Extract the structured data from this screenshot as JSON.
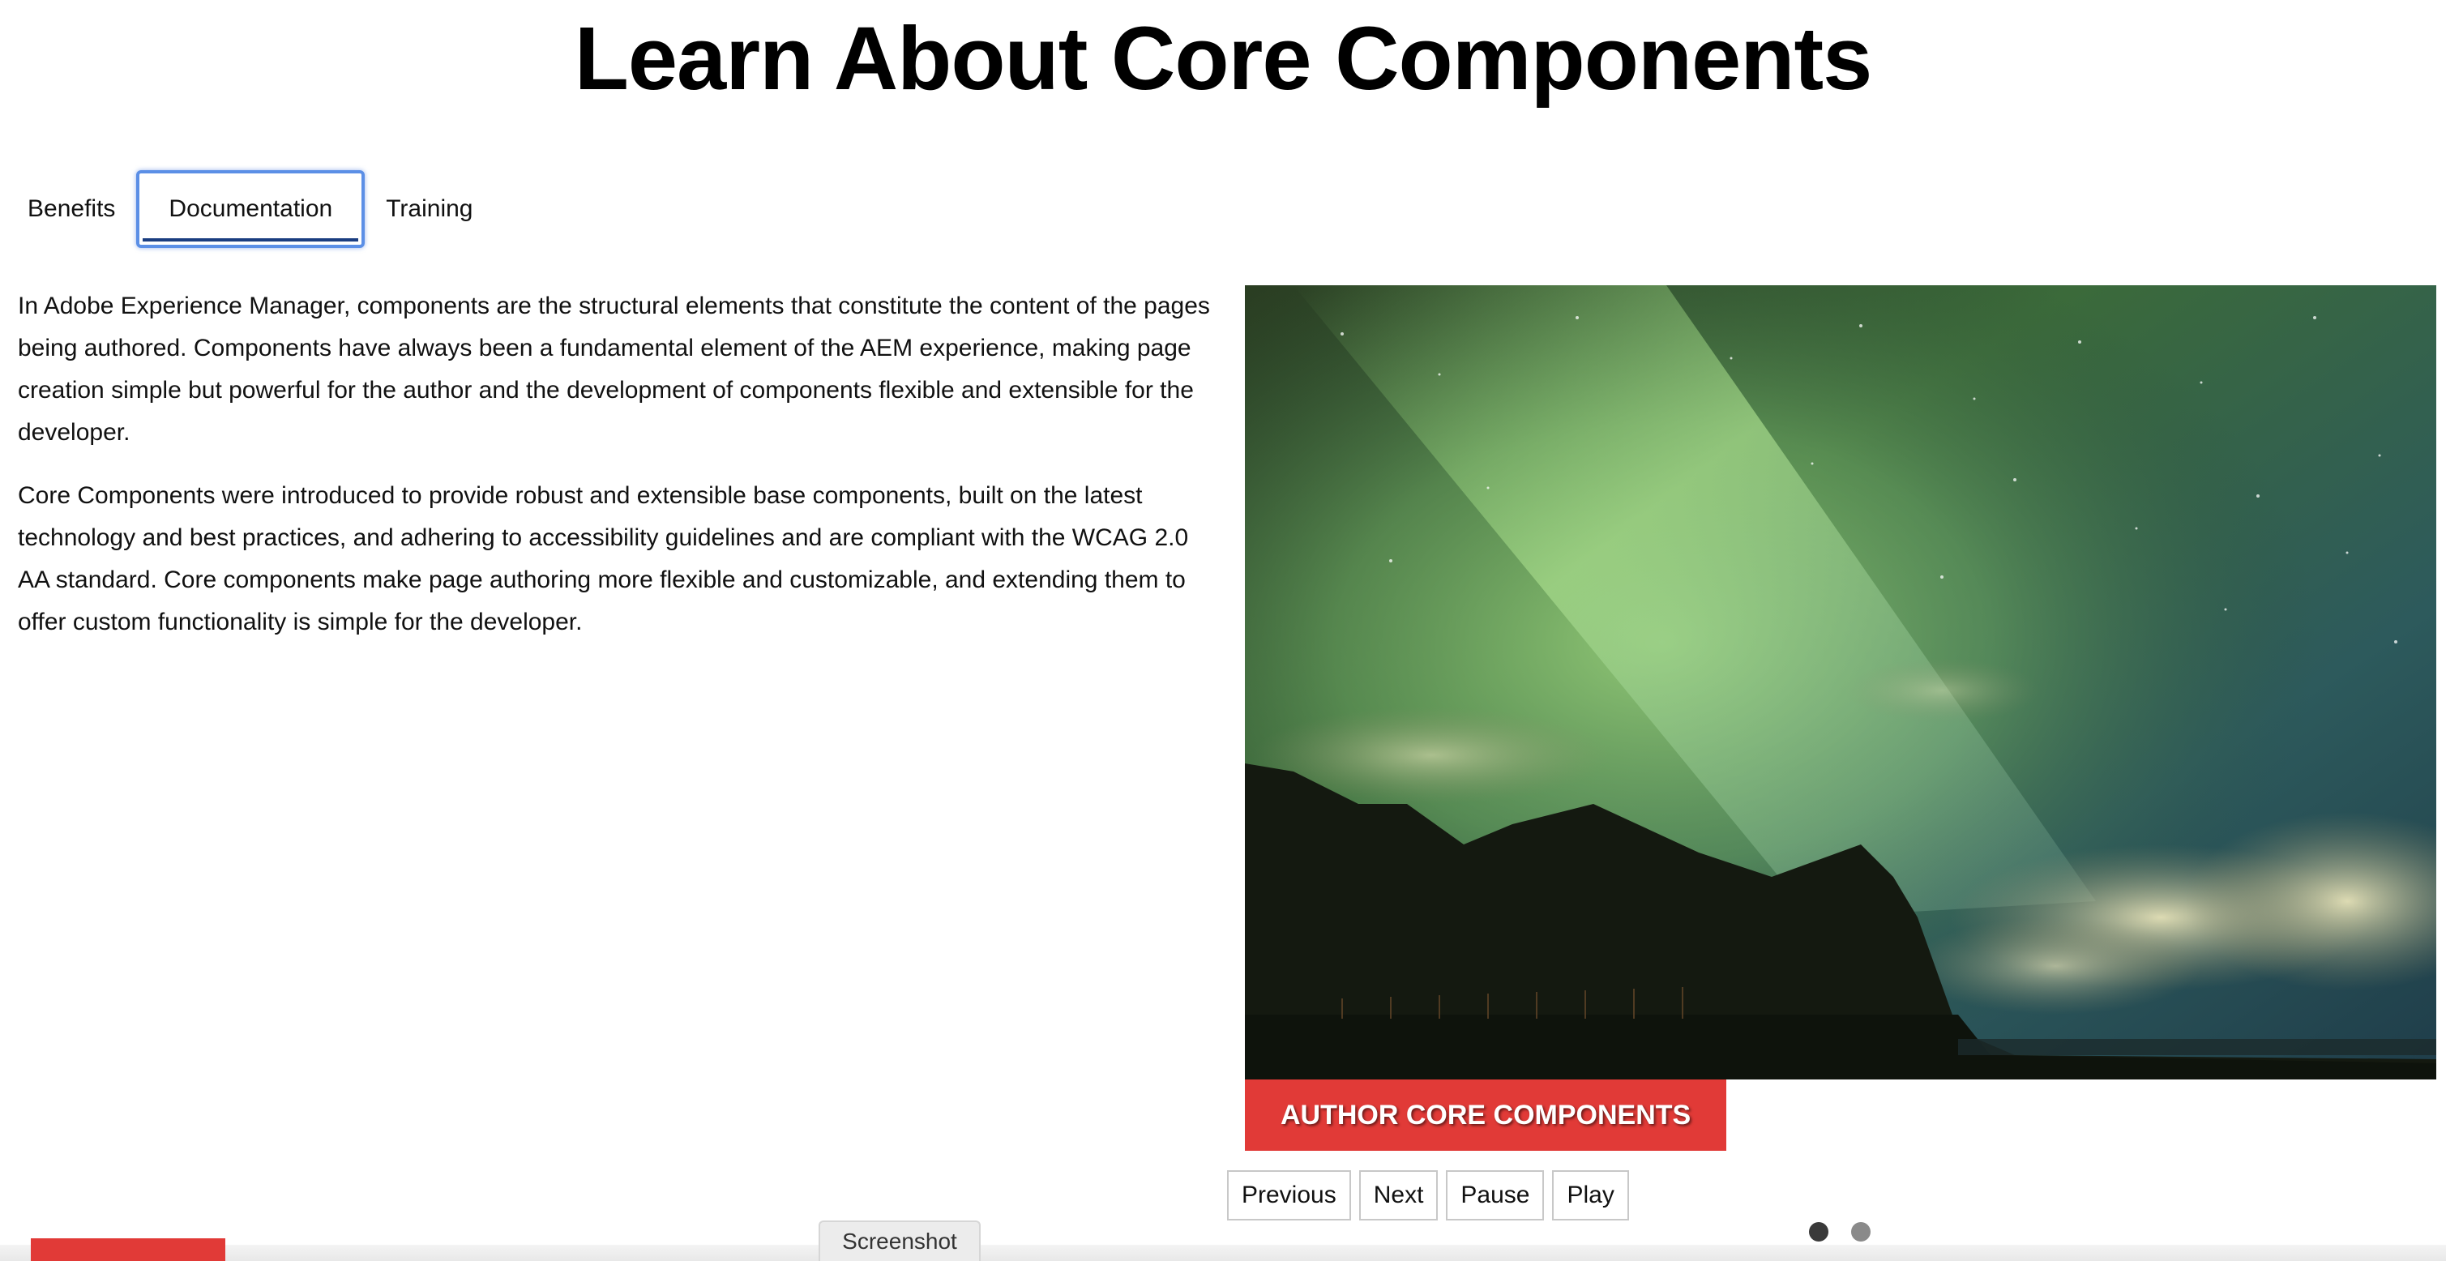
{
  "page": {
    "title": "Learn About Core Components"
  },
  "tabs": [
    {
      "label": "Benefits",
      "selected": false
    },
    {
      "label": "Documentation",
      "selected": true
    },
    {
      "label": "Training",
      "selected": false
    }
  ],
  "content": {
    "paragraphs": [
      "In Adobe Experience Manager, components are the structural elements that constitute the content of the pages being authored. Components have always been a fundamental element of the AEM experience, making page creation simple but powerful for the author and the development of components flexible and extensible for the developer.",
      "Core Components were introduced to provide robust and extensible base components, built on the latest technology and best practices, and adhering to accessibility guidelines and are compliant with the WCAG 2.0 AA standard. Core components make page authoring more flexible and customizable, and extending them to offer custom functionality is simple for the developer."
    ]
  },
  "carousel": {
    "caption": "AUTHOR CORE COMPONENTS",
    "controls": {
      "previous": "Previous",
      "next": "Next",
      "pause": "Pause",
      "play": "Play"
    },
    "indicator_count": 2,
    "active_indicator": 1
  },
  "footer": {
    "screenshot_label": "Screenshot"
  },
  "colors": {
    "accent_red": "#e13a37",
    "focus_blue": "#5b8fe6"
  },
  "icons": {
    "carousel_image": "aurora-landscape-image"
  }
}
